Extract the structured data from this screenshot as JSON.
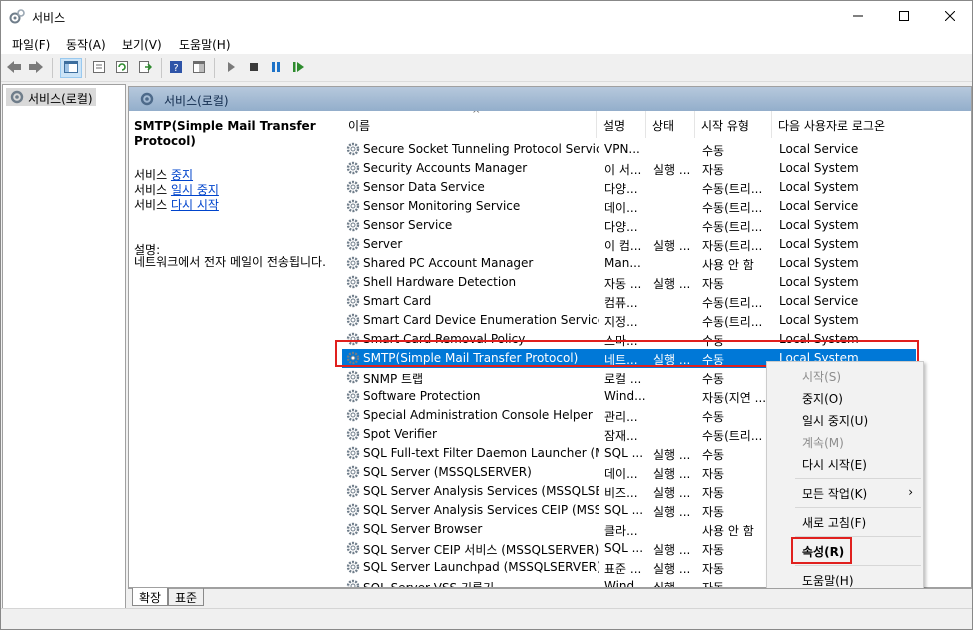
{
  "window": {
    "title": "서비스",
    "controls": {
      "minimize": "minimize-icon",
      "maximize": "maximize-icon",
      "close": "close-icon"
    }
  },
  "menu": [
    "파일(F)",
    "동작(A)",
    "보기(V)",
    "도움말(H)"
  ],
  "tree": {
    "root_label": "서비스(로컬)"
  },
  "header": {
    "label": "서비스(로컬)"
  },
  "description_pane": {
    "service_name": "SMTP(Simple Mail Transfer Protocol)",
    "actions": [
      {
        "prefix": "서비스 ",
        "link": "중지"
      },
      {
        "prefix": "서비스 ",
        "link": "일시 중지"
      },
      {
        "prefix": "서비스 ",
        "link": "다시 시작"
      }
    ],
    "desc_label": "설명:",
    "desc_text": "네트워크에서 전자 메일이 전송됩니다."
  },
  "columns": [
    "이름",
    "설명",
    "상태",
    "시작 유형",
    "다음 사용자로 로그온"
  ],
  "services": [
    {
      "name": "Secure Socket Tunneling Protocol Service",
      "desc": "VPN...",
      "status": "",
      "startup": "수동",
      "logon": "Local Service"
    },
    {
      "name": "Security Accounts Manager",
      "desc": "이 서...",
      "status": "실행 ...",
      "startup": "자동",
      "logon": "Local System"
    },
    {
      "name": "Sensor Data Service",
      "desc": "다양...",
      "status": "",
      "startup": "수동(트리...",
      "logon": "Local System"
    },
    {
      "name": "Sensor Monitoring Service",
      "desc": "데이...",
      "status": "",
      "startup": "수동(트리...",
      "logon": "Local Service"
    },
    {
      "name": "Sensor Service",
      "desc": "다양...",
      "status": "",
      "startup": "수동(트리...",
      "logon": "Local System"
    },
    {
      "name": "Server",
      "desc": "이 컴...",
      "status": "실행 ...",
      "startup": "자동(트리...",
      "logon": "Local System"
    },
    {
      "name": "Shared PC Account Manager",
      "desc": "Man...",
      "status": "",
      "startup": "사용 안 함",
      "logon": "Local System"
    },
    {
      "name": "Shell Hardware Detection",
      "desc": "자동 ...",
      "status": "실행 ...",
      "startup": "자동",
      "logon": "Local System"
    },
    {
      "name": "Smart Card",
      "desc": "컴퓨...",
      "status": "",
      "startup": "수동(트리...",
      "logon": "Local Service"
    },
    {
      "name": "Smart Card Device Enumeration Service",
      "desc": "지정...",
      "status": "",
      "startup": "수동(트리...",
      "logon": "Local System"
    },
    {
      "name": "Smart Card Removal Policy",
      "desc": "스마...",
      "status": "",
      "startup": "수동",
      "logon": "Local System"
    },
    {
      "name": "SMTP(Simple Mail Transfer Protocol)",
      "desc": "네트...",
      "status": "실행 ...",
      "startup": "수동",
      "logon": "Local System",
      "selected": true
    },
    {
      "name": "SNMP 트랩",
      "desc": "로컬 ...",
      "status": "",
      "startup": "수동",
      "logon": ""
    },
    {
      "name": "Software Protection",
      "desc": "Wind...",
      "status": "",
      "startup": "자동(지연 ...",
      "logon": ""
    },
    {
      "name": "Special Administration Console Helper",
      "desc": "관리...",
      "status": "",
      "startup": "수동",
      "logon": ""
    },
    {
      "name": "Spot Verifier",
      "desc": "잠재...",
      "status": "",
      "startup": "수동(트리...",
      "logon": ""
    },
    {
      "name": "SQL Full-text Filter Daemon Launcher (M...",
      "desc": "SQL ...",
      "status": "실행 ...",
      "startup": "수동",
      "logon": ""
    },
    {
      "name": "SQL Server (MSSQLSERVER)",
      "desc": "데이...",
      "status": "실행 ...",
      "startup": "자동",
      "logon": ""
    },
    {
      "name": "SQL Server Analysis Services (MSSQLSER...",
      "desc": "비즈...",
      "status": "실행 ...",
      "startup": "자동",
      "logon": ""
    },
    {
      "name": "SQL Server Analysis Services CEIP (MSSQ...",
      "desc": "SQL ...",
      "status": "실행 ...",
      "startup": "자동",
      "logon": ""
    },
    {
      "name": "SQL Server Browser",
      "desc": "클라...",
      "status": "",
      "startup": "사용 안 함",
      "logon": ""
    },
    {
      "name": "SQL Server CEIP 서비스 (MSSQLSERVER)",
      "desc": "SQL ...",
      "status": "실행 ...",
      "startup": "자동",
      "logon": ""
    },
    {
      "name": "SQL Server Launchpad (MSSQLSERVER)",
      "desc": "표준 ...",
      "status": "실행 ...",
      "startup": "자동",
      "logon": ""
    },
    {
      "name": "SQL Server VSS 기록기",
      "desc": "Wind...",
      "status": "실행 ...",
      "startup": "자동",
      "logon": ""
    }
  ],
  "context_menu": {
    "start": "시작(S)",
    "stop": "중지(O)",
    "pause": "일시 중지(U)",
    "resume": "계속(M)",
    "restart": "다시 시작(E)",
    "all_tasks": "모든 작업(K)",
    "refresh": "새로 고침(F)",
    "properties": "속성(R)",
    "help": "도움말(H)"
  },
  "tabs": [
    "확장",
    "표준"
  ],
  "colors": {
    "selection": "#0078d7",
    "highlight_box": "#e0201e",
    "header_gradient": "#a7bdd6"
  }
}
